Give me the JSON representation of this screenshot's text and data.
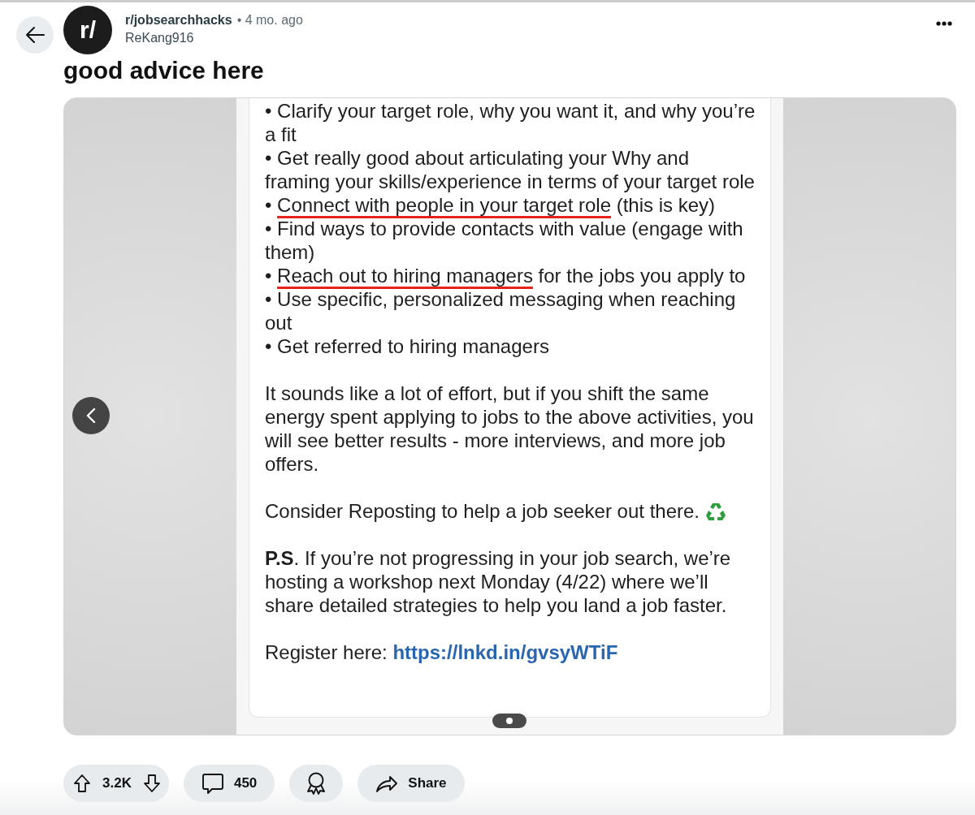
{
  "post": {
    "subreddit": "r/jobsearchhacks",
    "age": "• 4 mo. ago",
    "author": "ReKang916",
    "avatar_text": "r/",
    "title": "good advice here"
  },
  "image": {
    "bullets": [
      {
        "bullet": "•",
        "text": "Clarify your target role, why you want it, and why you’re a fit"
      },
      {
        "bullet": "•",
        "text": "Get really good about articulating your Why and framing your skills/experience in terms of your target role"
      },
      {
        "bullet": "•",
        "highlight": "Connect with people in your target role",
        "text": " (this is key)"
      },
      {
        "bullet": "•",
        "text": "Find ways to provide contacts with value (engage with them)"
      },
      {
        "bullet": "•",
        "highlight": "Reach out to hiring managers",
        "text": " for the jobs you apply to"
      },
      {
        "bullet": "•",
        "text": "Use specific, personalized messaging when reaching out"
      },
      {
        "bullet": "•",
        "text": "Get referred to hiring managers"
      }
    ],
    "paragraphs": [
      "It sounds like a lot of effort, but if you shift the same energy spent applying to jobs to the above activities, you will see better results - more interviews, and more job offers.",
      "Consider Reposting to help a job seeker out there.",
      "**P.S**. If you’re not progressing in your job search, we’re hosting a workshop next Monday (4/22) where we’ll share detailed strategies to help you land a job faster."
    ],
    "register_label": "Register here:",
    "register_link": "https://lnkd.in/gvsyWTiF"
  },
  "actions": {
    "score": "3.2K",
    "comments": "450",
    "share": "Share"
  }
}
